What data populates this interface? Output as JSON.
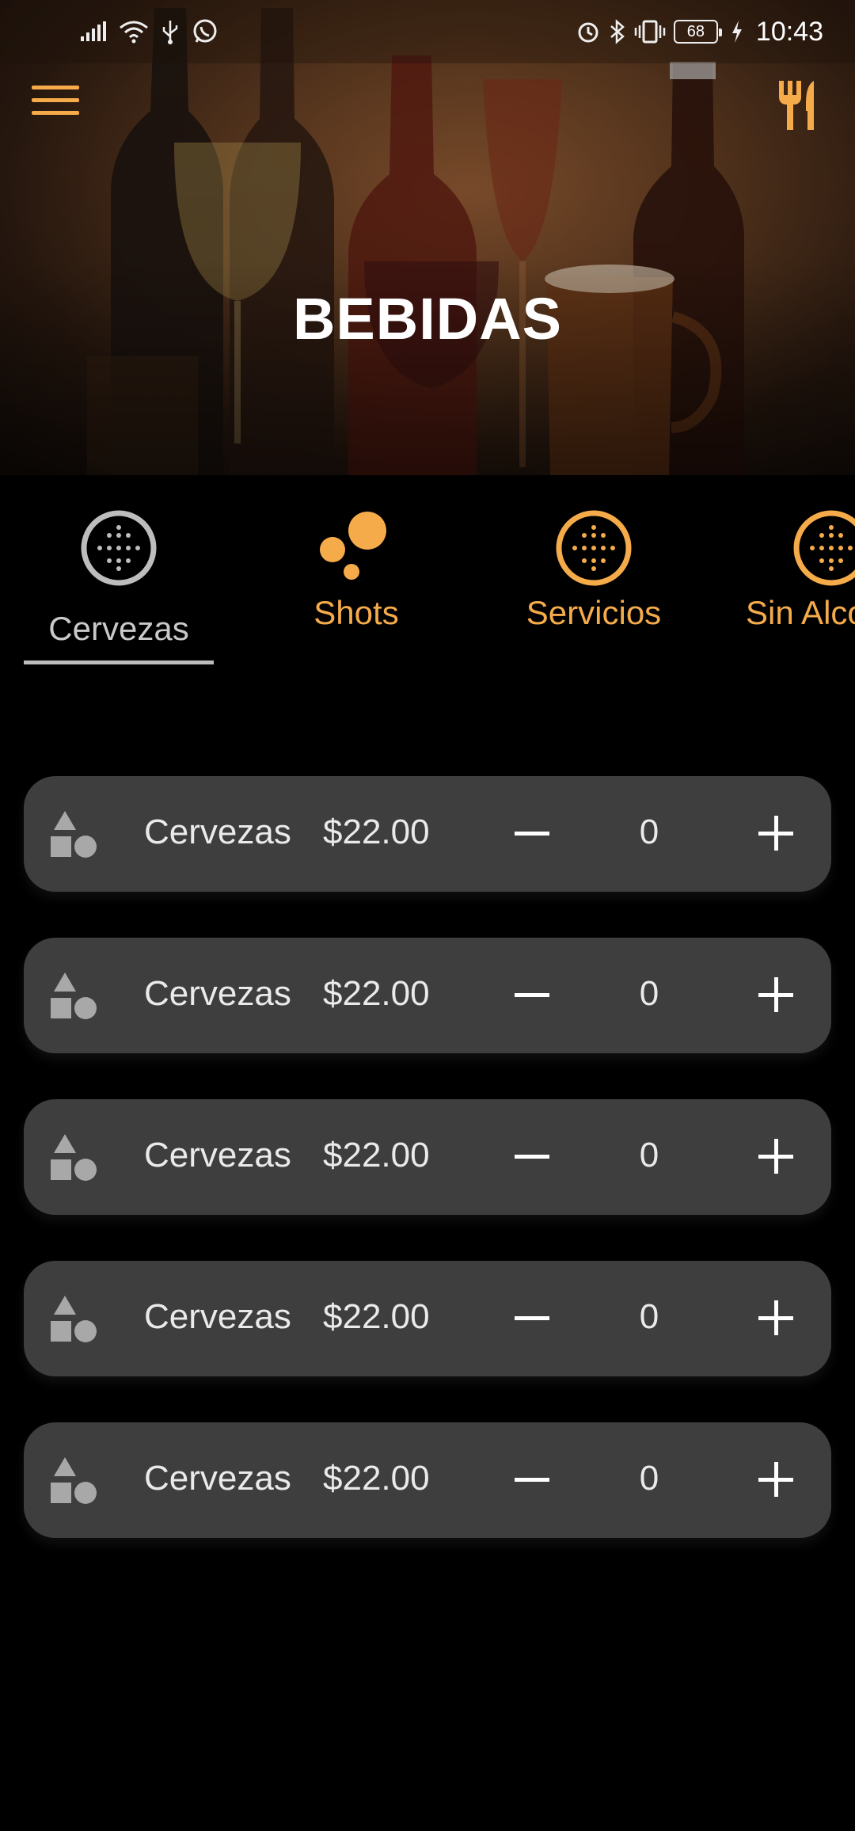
{
  "status_bar": {
    "time": "10:43",
    "battery": "68",
    "icons": [
      "signal-icon",
      "wifi-icon",
      "usb-icon",
      "whatsapp-icon",
      "alarm-icon",
      "bluetooth-icon",
      "vibrate-icon",
      "battery-icon",
      "charging-icon"
    ]
  },
  "header": {
    "title": "BEBIDAS",
    "menu_icon": "hamburger-menu-icon",
    "action_icon": "cutlery-icon"
  },
  "colors": {
    "accent": "#f6ab4b",
    "background": "#000000",
    "card": "#3e3e3e",
    "tab_selected": "#c9c9c9"
  },
  "tabs": [
    {
      "label": "Cervezas",
      "icon": "dot-grid-circle-icon",
      "selected": true
    },
    {
      "label": "Shots",
      "icon": "bubbles-icon",
      "selected": false
    },
    {
      "label": "Servicios",
      "icon": "dot-grid-circle-icon",
      "selected": false
    },
    {
      "label": "Sin Alco",
      "icon": "dot-grid-circle-icon",
      "selected": false
    }
  ],
  "items": [
    {
      "name": "Cervezas",
      "price": "$22.00",
      "quantity": "0",
      "icon": "shapes-icon"
    },
    {
      "name": "Cervezas",
      "price": "$22.00",
      "quantity": "0",
      "icon": "shapes-icon"
    },
    {
      "name": "Cervezas",
      "price": "$22.00",
      "quantity": "0",
      "icon": "shapes-icon"
    },
    {
      "name": "Cervezas",
      "price": "$22.00",
      "quantity": "0",
      "icon": "shapes-icon"
    },
    {
      "name": "Cervezas",
      "price": "$22.00",
      "quantity": "0",
      "icon": "shapes-icon"
    }
  ]
}
